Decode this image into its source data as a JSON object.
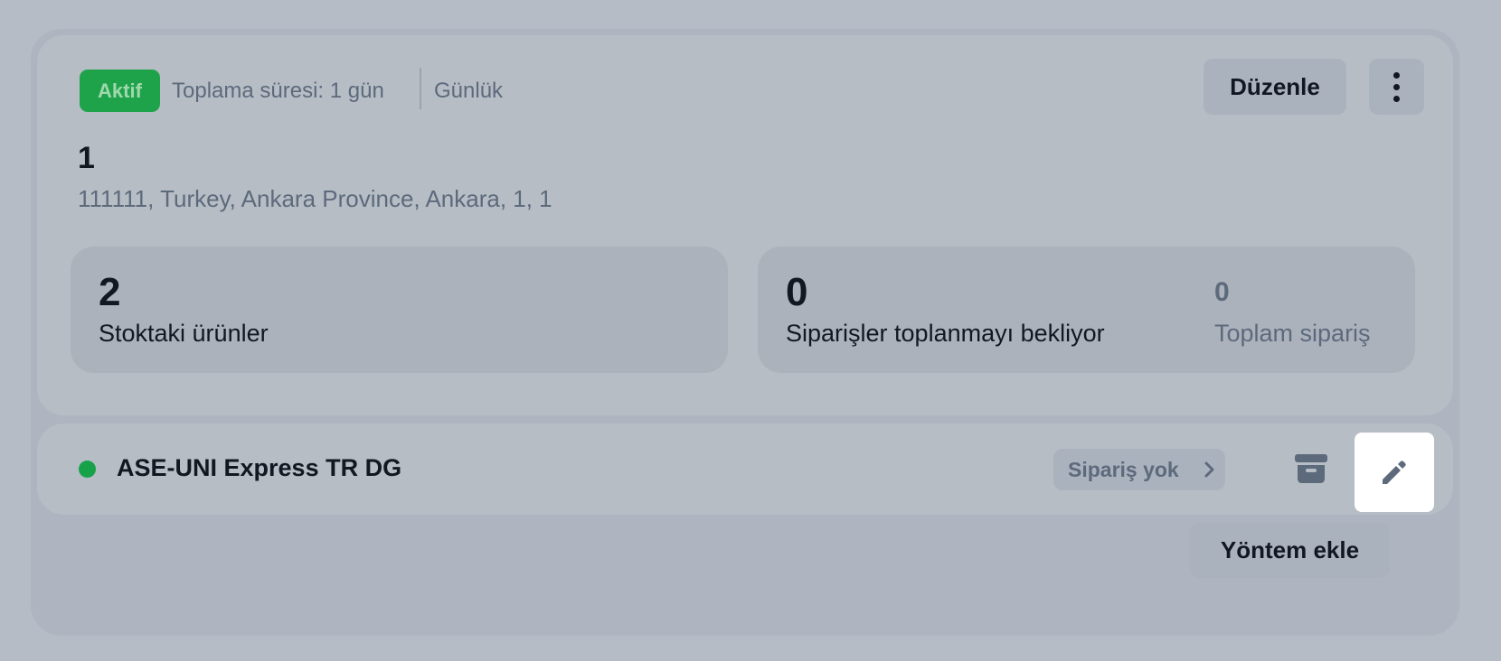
{
  "warehouse": {
    "status_badge": "Aktif",
    "collection_time": "Toplama süresi: 1 gün",
    "frequency": "Günlük",
    "edit_label": "Düzenle",
    "more_icon": "more-vertical-icon",
    "name": "1",
    "address": "111111, Turkey, Ankara Province, Ankara, 1, 1"
  },
  "stats": {
    "stock": {
      "value": "2",
      "label": "Stoktaki ürünler"
    },
    "orders": {
      "pending_value": "0",
      "pending_label": "Siparişler toplanmayı bekliyor",
      "total_value": "0",
      "total_label": "Toplam sipariş"
    }
  },
  "method": {
    "name": "ASE-UNI Express TR DG",
    "orders_label": "Sipariş yok",
    "status_color": "#17a24a",
    "archive_icon": "archive-icon",
    "edit_icon": "pencil-icon"
  },
  "add_method_label": "Yöntem ekle",
  "colors": {
    "active_badge": "#1ea34b",
    "text_primary": "#111822",
    "text_secondary": "#5d6a7c"
  }
}
